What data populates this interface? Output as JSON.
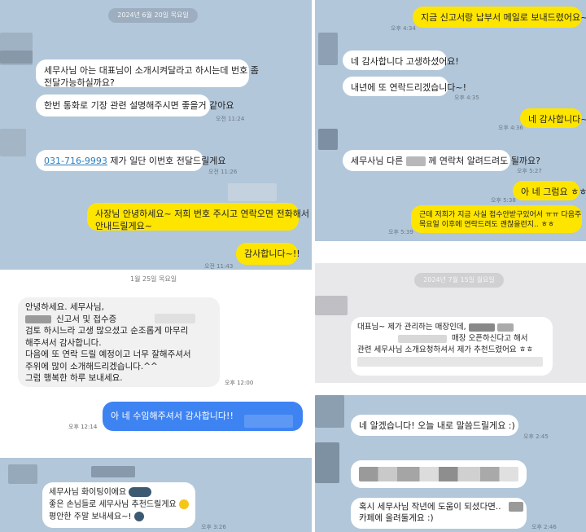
{
  "colors": {
    "chat_bg_blue": "#b2c7da",
    "yellow": "#fee500",
    "blue_bubble": "#3e83f2",
    "white": "#ffffff"
  },
  "icons": {
    "emoji_sunglasses": "sunglasses-emoji-icon",
    "emoji_grin": "grin-emoji-icon"
  },
  "p1": {
    "date": "2024년 6월 20일 목요일",
    "m1": [
      "세무사님 아는 대표님이 소개시켜달라고 하시는데 번호 좀",
      "전달가능하실까요?"
    ],
    "m2": "한번 통화로 기장 관련 설명해주시면 좋을거 같아요",
    "t2": "오전 11:24",
    "m3_phone": "031-716-9993",
    "m3_text": " 제가 일단 이번호 전달드릴게요",
    "t3": "오전 11:26",
    "m4": [
      "사장님 안녕하세요~ 저희 번호 주시고 연락오면 전화해서",
      "안내드릴게요~"
    ],
    "m5": "감사합니다~!!",
    "t5": "오전 11:43"
  },
  "p2": {
    "m1": "지금 신고서랑 납부서 메일로 보내드렸어요~!",
    "t1": "오후 4:34",
    "m2": "네 감사합니다 고생하셨어요!",
    "m3": "내년에 또 연락드리겠습니다~!",
    "t3": "오후 4:35",
    "m4": "네 감사합니다~!",
    "t4": "오후 4:36",
    "m5a": "세무사님 다른",
    "m5b": "께 연락처 알려드려도 될까요?",
    "t5": "오후 5:27",
    "m6": "아 네 그럼요 ㅎㅎ",
    "t6": "오후 5:38",
    "m7": [
      "근데 저희가 지금 사실 접수안받구있어서 ㅠㅠ 다음주",
      "목요일 이후에 연락드려도 괜찮을런지.. ㅎㅎ"
    ],
    "t7": "오후 5:39"
  },
  "p3": {
    "date": "1월 25일 목요일",
    "m1": [
      "안녕하세요. 세무사님,",
      "신고서 및 접수증",
      "검토 하시느라 고생 많으셨고 순조롭게 마무리",
      "해주셔서 감사합니다.",
      "다음에 또 연락 드릴 예정이고 너무 잘해주셔서",
      "주위에 많이 소개해드리겠습니다.^^",
      "그럼 행복한 하루 보내세요."
    ],
    "t1": "오후 12:00",
    "m2": "아 네 수임해주셔서 감사합니다!!",
    "t2": "오후 12:14"
  },
  "p4": {
    "date": "2024년 7월 15일 월요일",
    "m1a": "대표님~ 제가 관리하는 매장인데,",
    "m1b": "매장 오픈하신다고 해서",
    "m1c": "관련 세무사님 소개요청하셔서 제가 추천드렸어요 ㅎㅎ"
  },
  "p5": {
    "m1": "세무사님 화이팅이에요",
    "m2": "좋은 손님들로 세무사님 추천드릴게요",
    "m3": "평안한 주말 보내세요~!",
    "t1": "오후 3:26"
  },
  "p6": {
    "m1": "네 알겠습니다! 오늘 내로 말씀드릴게요 :)",
    "t1": "오후 2:45",
    "m3a": "혹시 세무사님 작년에 도움이 되셨다면..",
    "m3b": "카페에 올려둘게요 :)",
    "t3": "오후 2:46"
  }
}
